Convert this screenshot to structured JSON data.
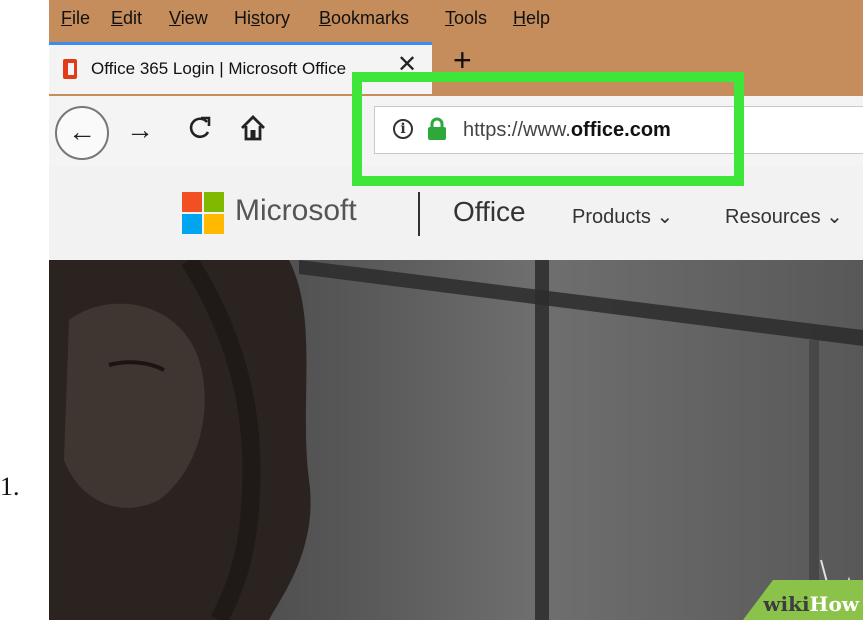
{
  "list_number": "1.",
  "menu": {
    "items": [
      {
        "mnemonic": "F",
        "rest": "ile"
      },
      {
        "mnemonic": "E",
        "rest": "dit"
      },
      {
        "mnemonic": "V",
        "rest": "iew"
      },
      {
        "pre": "Hi",
        "mnemonic": "s",
        "rest": "tory"
      },
      {
        "mnemonic": "B",
        "rest": "ookmarks"
      },
      {
        "mnemonic": "T",
        "rest": "ools"
      },
      {
        "mnemonic": "H",
        "rest": "elp"
      }
    ]
  },
  "tab": {
    "title": "Office 365 Login | Microsoft Office",
    "close_glyph": "✕",
    "favicon": "office-logo-icon"
  },
  "toolbar": {
    "newtab_glyph": "+",
    "back_glyph": "←",
    "forward_glyph": "→",
    "reload_glyph": "C",
    "info_glyph": "i",
    "url_prefix": "https://www.",
    "url_domain": "office.com"
  },
  "site_header": {
    "brand": "Microsoft",
    "product": "Office",
    "nav": [
      "Products ⌄",
      "Resources ⌄"
    ]
  },
  "watermark": {
    "wiki": "wiki",
    "how": "How"
  },
  "colors": {
    "menu_bg": "#c68d5c",
    "highlight": "#3ee63a",
    "lock_green": "#2ea83a",
    "tab_accent": "#3d8bf0",
    "ms_red": "#f25022",
    "ms_green": "#7fba00",
    "ms_blue": "#00a4ef",
    "ms_yellow": "#ffb900"
  }
}
